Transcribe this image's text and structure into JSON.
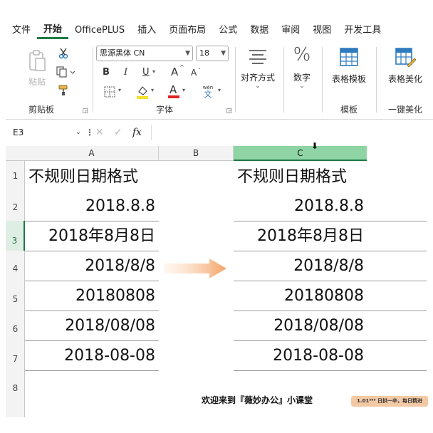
{
  "menu": {
    "tabs": [
      {
        "label": "文件",
        "active": false
      },
      {
        "label": "开始",
        "active": true
      },
      {
        "label": "OfficePLUS",
        "active": false
      },
      {
        "label": "插入",
        "active": false
      },
      {
        "label": "页面布局",
        "active": false
      },
      {
        "label": "公式",
        "active": false
      },
      {
        "label": "数据",
        "active": false
      },
      {
        "label": "审阅",
        "active": false
      },
      {
        "label": "视图",
        "active": false
      },
      {
        "label": "开发工具",
        "active": false
      }
    ]
  },
  "ribbon": {
    "clipboard": {
      "label": "剪贴板",
      "paste_label": "粘贴"
    },
    "font": {
      "label": "字体",
      "font_name": "思源黑体 CN",
      "font_size": "18",
      "bold": "B",
      "italic": "I",
      "underline": "U",
      "grow": "A",
      "shrink": "A",
      "phonetic": "wén"
    },
    "alignment": {
      "label": "对齐方式"
    },
    "number": {
      "label": "数字",
      "symbol": "%"
    },
    "template": {
      "button_label": "表格模板",
      "group_label": "模板"
    },
    "beautify": {
      "button_label": "表格美化",
      "group_label": "一键美化"
    }
  },
  "formula_bar": {
    "name_box": "E3",
    "fx": "fx",
    "formula": ""
  },
  "sheet": {
    "columns": [
      "A",
      "B",
      "C"
    ],
    "selected_column": "C",
    "active_row": "3",
    "rows": [
      {
        "num": "1",
        "a": "不规则日期格式",
        "c": "不规则日期格式"
      },
      {
        "num": "2",
        "a": "2018.8.8",
        "c": "2018.8.8"
      },
      {
        "num": "3",
        "a": "2018年8月8日",
        "c": "2018年8月8日"
      },
      {
        "num": "4",
        "a": "2018/8/8",
        "c": "2018/8/8"
      },
      {
        "num": "5",
        "a": "20180808",
        "c": "20180808"
      },
      {
        "num": "6",
        "a": "2018/08/08",
        "c": "2018/08/08"
      },
      {
        "num": "7",
        "a": "2018-08-08",
        "c": "2018-08-08"
      },
      {
        "num": "8",
        "a": "",
        "c": ""
      }
    ]
  },
  "footer": {
    "text": "欢迎来到『薇妙办公』小课堂",
    "badge": "1.01³⁶⁵ 日拱一卒，每日精进"
  },
  "colors": {
    "accent_green": "#1e7a44",
    "selected_column": "#8fd4a4",
    "arrow": "#f3a265",
    "badge_bg": "#f2c9a4"
  }
}
